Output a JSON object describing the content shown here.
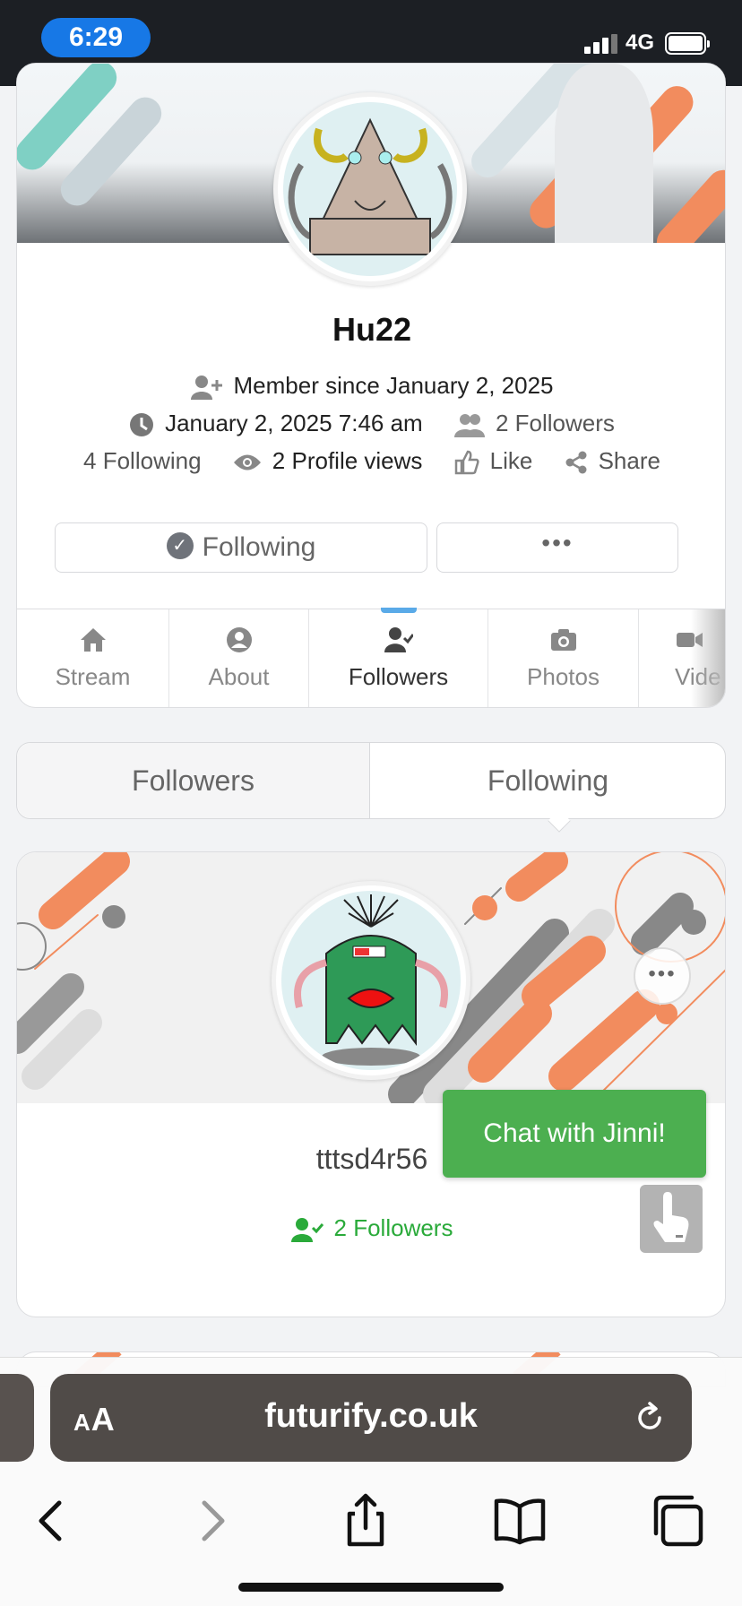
{
  "status": {
    "time": "6:29",
    "network": "4G"
  },
  "profile": {
    "username": "Hu22",
    "member_since": "Member since January 2, 2025",
    "joined_time": "January 2, 2025 7:46 am",
    "followers_count": "2",
    "followers_label": "Followers",
    "following_count": "4",
    "following_label": "Following",
    "profile_views_count": "2",
    "profile_views_label": "Profile views",
    "like_label": "Like",
    "share_label": "Share",
    "following_button": "Following",
    "more_button": "•••"
  },
  "tabs": [
    {
      "label": "Stream",
      "icon": "home-icon"
    },
    {
      "label": "About",
      "icon": "user-circle-icon"
    },
    {
      "label": "Followers",
      "icon": "user-check-icon",
      "active": true
    },
    {
      "label": "Photos",
      "icon": "camera-icon"
    },
    {
      "label": "Vide",
      "icon": "video-icon"
    }
  ],
  "segment": {
    "left": "Followers",
    "right": "Following"
  },
  "follower": {
    "name": "tttsd4r56",
    "followers": "2 Followers",
    "more": "•••"
  },
  "chat": {
    "label": "Chat with Jinni!"
  },
  "browser": {
    "aa_big": "A",
    "aa_small": "A",
    "url": "futurify.co.uk"
  },
  "colors": {
    "accent_blue": "#1778e6",
    "green": "#4caf50",
    "follow_green": "#2aaa3a",
    "orange": "#f28c5e"
  }
}
